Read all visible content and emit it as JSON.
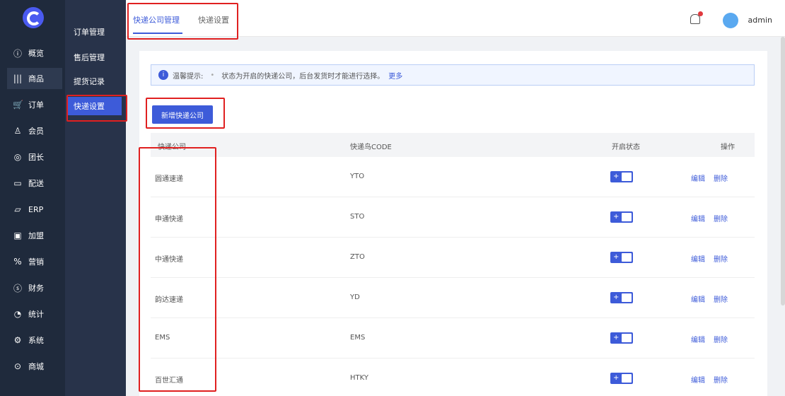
{
  "nav": {
    "items": [
      {
        "label": "概览",
        "icon": "info-circle-icon"
      },
      {
        "label": "商品",
        "icon": "barcode-icon"
      },
      {
        "label": "订单",
        "icon": "cart-icon"
      },
      {
        "label": "会员",
        "icon": "user-icon"
      },
      {
        "label": "团长",
        "icon": "medal-icon"
      },
      {
        "label": "配送",
        "icon": "truck-icon"
      },
      {
        "label": "ERP",
        "icon": "erp-icon"
      },
      {
        "label": "加盟",
        "icon": "shield-icon"
      },
      {
        "label": "营销",
        "icon": "coupon-icon"
      },
      {
        "label": "财务",
        "icon": "moneybag-icon"
      },
      {
        "label": "统计",
        "icon": "pie-icon"
      },
      {
        "label": "系统",
        "icon": "gear-icon"
      },
      {
        "label": "商城",
        "icon": "compass-icon"
      }
    ]
  },
  "subnav": {
    "items": [
      "订单管理",
      "售后管理",
      "提货记录",
      "快递设置"
    ]
  },
  "topbar": {
    "tabs": [
      "快递公司管理",
      "快递设置"
    ],
    "user": "admin"
  },
  "tip": {
    "label": "温馨提示:",
    "text": "状态为开启的快递公司，后台发货时才能进行选择。",
    "more": "更多"
  },
  "add_button": "新增快递公司",
  "table": {
    "headers": [
      "快递公司",
      "快递鸟CODE",
      "开启状态",
      "操作"
    ],
    "rows": [
      {
        "name": "圆通速递",
        "code": "YTO"
      },
      {
        "name": "申通快递",
        "code": "STO"
      },
      {
        "name": "中通快递",
        "code": "ZTO"
      },
      {
        "name": "韵达速递",
        "code": "YD"
      },
      {
        "name": "EMS",
        "code": "EMS"
      },
      {
        "name": "百世汇通",
        "code": "HTKY"
      }
    ],
    "edit": "编辑",
    "delete": "删除"
  },
  "colors": {
    "accent": "#3d5bd9",
    "nav_bg": "#1f2a3c",
    "highlight": "#e02020"
  }
}
